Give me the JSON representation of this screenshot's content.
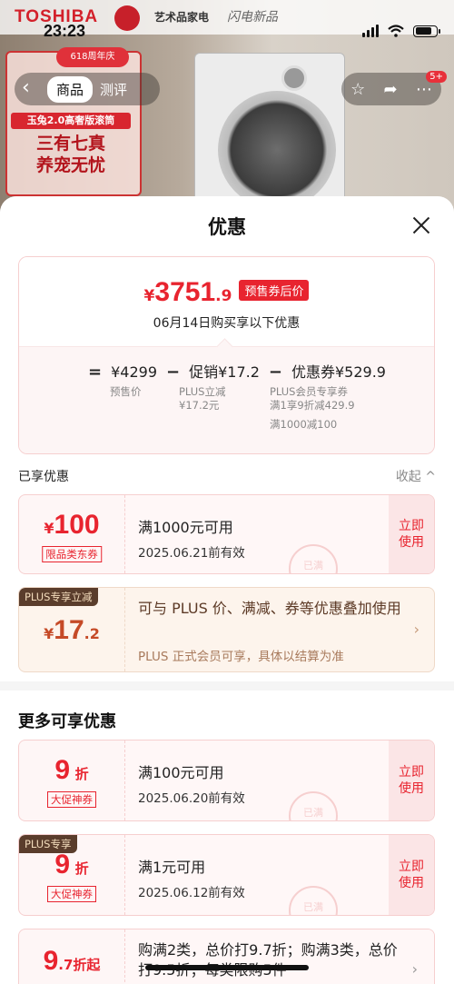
{
  "status_bar": {
    "time": "23:23"
  },
  "background": {
    "brand": "TOSHIBA",
    "tagline1": "艺术品家电",
    "tagline2": "闪电新品",
    "anniversary": "618周年庆",
    "model": "玉兔2.0高奢版滚筒",
    "slogan_line1": "三有七真",
    "slogan_line2": "养宠无忧",
    "cart_badge": "5+"
  },
  "nav": {
    "tab_product": "商品",
    "tab_review": "测评"
  },
  "sheet": {
    "title": "优惠"
  },
  "price_card": {
    "yen": "¥",
    "price_int": "3751",
    "price_dec": ".9",
    "price_tag": "预售券后价",
    "subtitle": "06月14日购买享以下优惠",
    "equals": "=",
    "presale_price": "¥4299",
    "presale_label": "预售价",
    "minus1": "−",
    "promo_value": "促销¥17.2",
    "promo_detail_1": "PLUS立减",
    "promo_detail_2": "¥17.2元",
    "minus2": "−",
    "coupon_value": "优惠券¥529.9",
    "coupon_detail_1": "PLUS会员专享券",
    "coupon_detail_2": "满1享9折减429.9",
    "coupon_detail_3": "满1000减100"
  },
  "enjoyed": {
    "title": "已享优惠",
    "collapse": "收起 ^"
  },
  "coupons_enjoyed": [
    {
      "yen": "¥",
      "amount": "100",
      "label": "限品类东券",
      "condition": "满1000元可用",
      "date": "2025.06.21前有效",
      "action_line1": "立即",
      "action_line2": "使用",
      "stamp": "已满"
    }
  ],
  "plus_card": {
    "tag": "PLUS专享立减",
    "yen": "¥",
    "amount_int": "17",
    "amount_dec": ".2",
    "text": "可与 PLUS 价、满减、券等优惠叠加使用",
    "note": "PLUS 正式会员可享，具体以结算为准",
    "arrow": "›"
  },
  "more": {
    "title": "更多可享优惠",
    "coupons": [
      {
        "tag": "",
        "num": "9",
        "unit": "折",
        "label": "大促神券",
        "condition": "满100元可用",
        "date": "2025.06.20前有效",
        "action_line1": "立即",
        "action_line2": "使用",
        "stamp": "已满"
      },
      {
        "tag": "PLUS专享",
        "num": "9",
        "unit": "折",
        "label": "大促神券",
        "condition": "满1元可用",
        "date": "2025.06.12前有效",
        "action_line1": "立即",
        "action_line2": "使用",
        "stamp": "已满"
      }
    ],
    "multi": {
      "num": "9",
      "unit": ".7折起",
      "text": "购满2类，总价打9.7折；购满3类，总价打9.5折；每类限购5件",
      "arrow": "›"
    }
  }
}
